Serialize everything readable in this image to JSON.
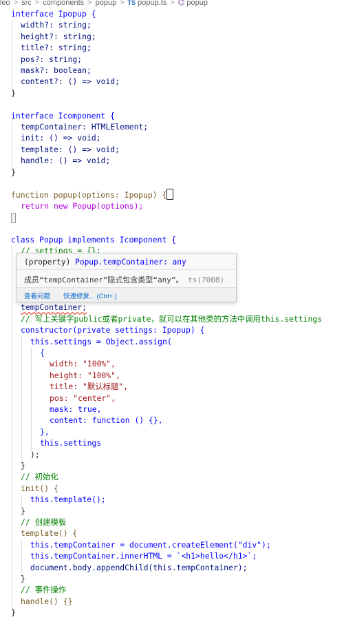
{
  "breadcrumb": {
    "items": [
      "leo",
      "src",
      "components",
      "popup"
    ],
    "file_badge": "TS",
    "file": "popup.ts",
    "symbol": "popup",
    "separator": ">"
  },
  "hover": {
    "signature_prefix": "(property) ",
    "signature_body": "Popup.tempContainer: any",
    "message": "成员“tempContainer”隐式包含类型“any”。",
    "code": "ts(7008)",
    "action_view_problem": "查看问题",
    "action_quick_fix": "快速修复... (Ctrl+.)"
  },
  "code": {
    "l01": "interface Ipopup {",
    "l02": "width?: string;",
    "l03": "height?: string;",
    "l04": "title?: string;",
    "l05": "pos?: string;",
    "l06": "mask?: boolean;",
    "l07": "content?: () => void;",
    "l08": "}",
    "l09": "interface Icomponent {",
    "l10": "tempContainer: HTMLElement;",
    "l11": "init: () => void;",
    "l12": "template: () => void;",
    "l13": "handle: () => void;",
    "l14": "}",
    "l15": "function popup(options: Ipopup) {",
    "l16": "return new Popup(options);",
    "l17": "class Popup implements Icomponent {",
    "l18": "// settings = {};",
    "l19": "tempContainer;",
    "l20": "// 写上关键字public或者private，就可以在其他类的方法中调用this.settings",
    "l21": "constructor(private settings: Ipopup) {",
    "l22": "this.settings = Object.assign(",
    "l23": "{",
    "l24": "width: \"100%\",",
    "l25": "height: \"100%\",",
    "l26": "title: \"默认标题\",",
    "l27": "pos: \"center\",",
    "l28": "mask: true,",
    "l29": "content: function () {},",
    "l30": "},",
    "l31": "this.settings",
    "l32": ");",
    "l33": "}",
    "l34": "// 初始化",
    "l35": "init() {",
    "l36": "this.template();",
    "l37": "}",
    "l38": "// 创建模板",
    "l39": "template() {",
    "l40": "this.tempContainer = document.createElement(\"div\");",
    "l41": "this.tempContainer.innerHTML = `<h1>hello</h1>`;",
    "l42": "document.body.appendChild(this.tempContainer);",
    "l43": "}",
    "l44": "// 事件操作",
    "l45": "handle() {}",
    "l46": "}"
  },
  "colors": {
    "keyword": "#0000ff",
    "control_keyword": "#af00db",
    "type": "#267f99",
    "function": "#795e26",
    "property": "#001080",
    "string": "#a31515",
    "comment": "#008000",
    "error_squiggle": "#e51400"
  }
}
